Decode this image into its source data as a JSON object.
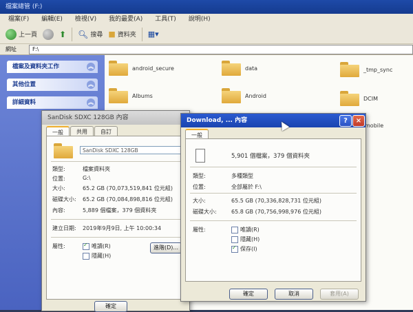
{
  "explorer": {
    "title": "檔案總管 (F:)",
    "menu": [
      "檔案(F)",
      "編輯(E)",
      "檢視(V)",
      "我的最愛(A)",
      "工具(T)",
      "說明(H)"
    ],
    "toolbar": {
      "back": "上一頁",
      "search": "搜尋",
      "folders": "資料夾"
    },
    "address_label": "網址(D)",
    "address_value": "F:\\",
    "taskpane": [
      "檔案及資料夾工作",
      "其他位置",
      "詳細資料"
    ],
    "folders": [
      "android_secure",
      "data",
      "_tmp_sync",
      "Albums",
      "Android",
      "DCIM",
      "mobile"
    ]
  },
  "dialog_drive": {
    "title": "SanDisk SDXC 128GB 內容",
    "tabs": [
      "一般",
      "共用",
      "自訂"
    ],
    "name_value": "SanDisk SDXC 128GB",
    "rows": [
      {
        "label": "類型:",
        "value": "檔案資料夾"
      },
      {
        "label": "位置:",
        "value": "G:\\"
      },
      {
        "label": "大小:",
        "value": "65.2 GB (70,073,519,841 位元組)"
      },
      {
        "label": "磁碟大小:",
        "value": "65.2 GB (70,084,898,816 位元組)"
      },
      {
        "label": "內容:",
        "value": "5,889 個檔案，379 個資料夾"
      }
    ],
    "created_label": "建立日期:",
    "created_value": "2019年9月9日, 上午 10:00:34",
    "attr_label": "屬性:",
    "attrs": [
      {
        "label": "唯讀(R)",
        "checked": true
      },
      {
        "label": "隱藏(H)",
        "checked": false
      }
    ],
    "advanced_button": "進階(D)...",
    "ok_button": "確定"
  },
  "dialog_download": {
    "title": "Download, ... 內容",
    "help_icon": "?",
    "close_icon": "×",
    "tab": "一般",
    "summary": "5,901 個檔案，379 個資料夾",
    "rows": [
      {
        "label": "類型:",
        "value": "多種類型"
      },
      {
        "label": "位置:",
        "value": "全部屬於 F:\\"
      },
      {
        "label": "大小:",
        "value": "65.5 GB (70,336,828,731 位元組)"
      },
      {
        "label": "磁碟大小:",
        "value": "65.8 GB (70,756,998,976 位元組)"
      }
    ],
    "attr_label": "屬性:",
    "attrs": [
      {
        "label": "唯讀(R)",
        "checked": false
      },
      {
        "label": "隱藏(H)",
        "checked": false
      },
      {
        "label": "保存(I)",
        "checked": true
      }
    ],
    "ok_button": "確定",
    "cancel_button": "取消",
    "apply_button": "套用(A)"
  }
}
